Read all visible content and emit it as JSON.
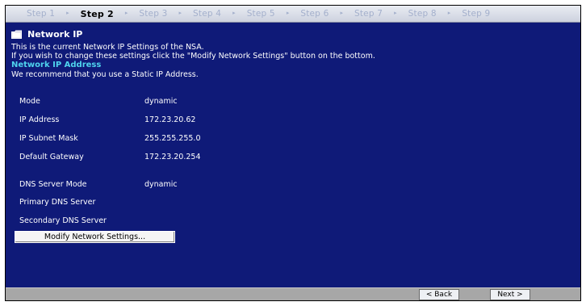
{
  "steps": [
    {
      "label": "Step 1"
    },
    {
      "label": "Step 2"
    },
    {
      "label": "Step 3"
    },
    {
      "label": "Step 4"
    },
    {
      "label": "Step 5"
    },
    {
      "label": "Step 6"
    },
    {
      "label": "Step 7"
    },
    {
      "label": "Step 8"
    },
    {
      "label": "Step 9"
    }
  ],
  "active_step": "Step 2",
  "step_separator": "▸",
  "page": {
    "title": "Network IP",
    "icon": "folder-icon",
    "description_line1": "This is the current Network IP Settings of the NSA.",
    "description_line2": "If you wish to change these settings click the \"Modify Network Settings\" button on the bottom.",
    "section_heading": "Network IP Address",
    "recommendation": "We recommend that you use a Static IP Address."
  },
  "fields": {
    "mode": {
      "label": "Mode",
      "value": "dynamic"
    },
    "ip_address": {
      "label": "IP Address",
      "value": "172.23.20.62"
    },
    "subnet_mask": {
      "label": "IP Subnet Mask",
      "value": "255.255.255.0"
    },
    "gateway": {
      "label": "Default Gateway",
      "value": "172.23.20.254"
    },
    "dns_mode": {
      "label": "DNS Server Mode",
      "value": "dynamic"
    },
    "primary_dns": {
      "label": "Primary DNS Server",
      "value": ""
    },
    "secondary_dns": {
      "label": "Secondary DNS Server",
      "value": ""
    }
  },
  "buttons": {
    "modify": "Modify Network Settings...",
    "back": "< Back",
    "next": "Next >"
  },
  "colors": {
    "panel_bg": "#0f1a78",
    "section_heading": "#4fd4ee",
    "step_inactive": "#a4b0cc",
    "step_active": "#000000",
    "bottom_bar": "#a7a7a7"
  }
}
